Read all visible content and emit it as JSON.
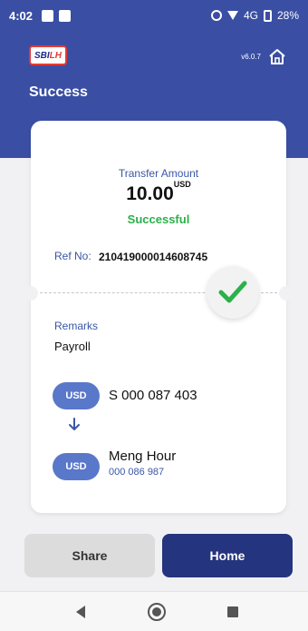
{
  "statusbar": {
    "time": "4:02",
    "network": "4G",
    "battery": "28%"
  },
  "header": {
    "logo": {
      "left": "SBI",
      "right": "LH"
    },
    "version": "v6.0.7",
    "title": "Success"
  },
  "card": {
    "transfer_label": "Transfer Amount",
    "amount": "10.00",
    "currency": "USD",
    "status": "Successful",
    "ref_label": "Ref No:",
    "ref_value": "210419000014608745",
    "remarks_label": "Remarks",
    "remarks_value": "Payroll",
    "from": {
      "currency": "USD",
      "account": "S 000 087 403"
    },
    "to": {
      "currency": "USD",
      "name": "Meng Hour",
      "account": "000 086 987"
    }
  },
  "buttons": {
    "share": "Share",
    "home": "Home"
  },
  "colors": {
    "brand_blue": "#3a4fa3",
    "dark_blue": "#25347e",
    "success_green": "#2bb04a",
    "pill_blue": "#5a78c9"
  },
  "icons": [
    "home-icon",
    "check-icon",
    "arrow-down-icon",
    "nav-back-icon",
    "nav-home-icon",
    "nav-recent-icon"
  ]
}
